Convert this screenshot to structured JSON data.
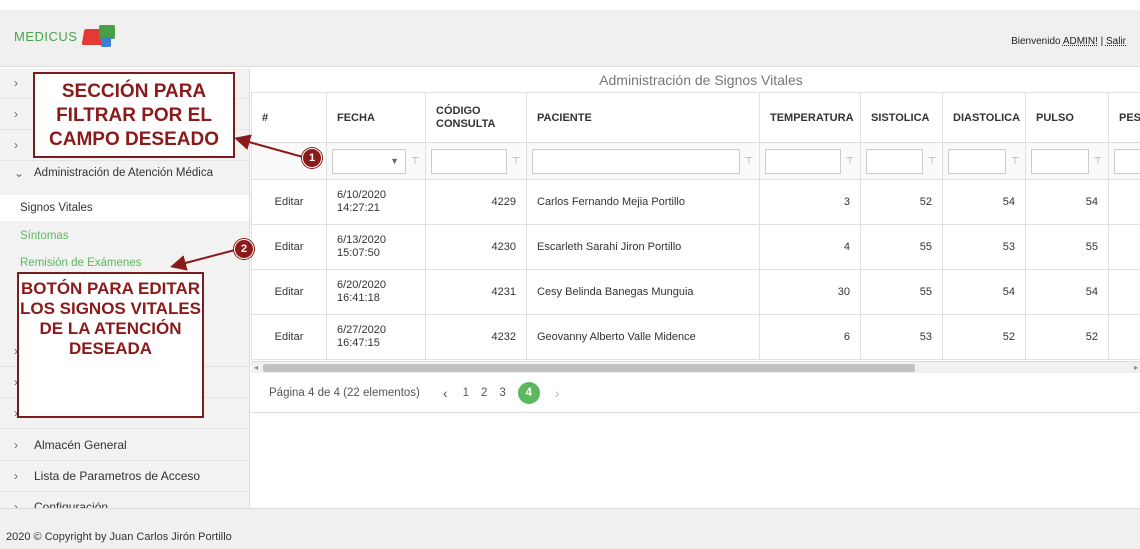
{
  "header": {
    "logo_text": "MEDICUS",
    "welcome_prefix": "Bienvenido",
    "user_link": "ADMIN!",
    "separator": "|",
    "logout_link": "Salir"
  },
  "sidebar": {
    "chevron_right": "›",
    "chevron_down": "⌄",
    "section_label": "Administración de Atención Médica",
    "sub_items": [
      {
        "label": "Signos Vitales"
      },
      {
        "label": "Síntomas"
      },
      {
        "label": "Remisión de Exámenes"
      }
    ],
    "bottom_items": [
      {
        "label": "Almacén General"
      },
      {
        "label": "Lista de Parametros de Acceso"
      },
      {
        "label": "Configuración"
      }
    ]
  },
  "grid": {
    "title": "Administración de Signos Vitales",
    "columns": [
      "#",
      "FECHA",
      "CÓDIGO CONSULTA",
      "PACIENTE",
      "TEMPERATURA",
      "SISTOLICA",
      "DIASTOLICA",
      "PULSO",
      "PES"
    ],
    "rows": [
      {
        "action": "Editar",
        "date": "6/10/2020",
        "time": "14:27:21",
        "code": "4229",
        "patient": "Carlos Fernando Mejia Portillo",
        "temp": "3",
        "sys": "52",
        "dia": "54",
        "pulse": "54"
      },
      {
        "action": "Editar",
        "date": "6/13/2020",
        "time": "15:07:50",
        "code": "4230",
        "patient": "Escarleth Sarahi Jiron Portillo",
        "temp": "4",
        "sys": "55",
        "dia": "53",
        "pulse": "55"
      },
      {
        "action": "Editar",
        "date": "6/20/2020",
        "time": "16:41:18",
        "code": "4231",
        "patient": "Cesy Belinda Banegas Munguia",
        "temp": "30",
        "sys": "55",
        "dia": "54",
        "pulse": "54"
      },
      {
        "action": "Editar",
        "date": "6/27/2020",
        "time": "16:47:15",
        "code": "4232",
        "patient": "Geovanny Alberto Valle Midence",
        "temp": "6",
        "sys": "53",
        "dia": "52",
        "pulse": "52"
      }
    ]
  },
  "pager": {
    "info": "Página 4 de 4 (22 elementos)",
    "prev": "‹",
    "next": "›",
    "pages": [
      "1",
      "2",
      "3",
      "4"
    ],
    "current": "4"
  },
  "footer": {
    "text": "2020 © Copyright by Juan Carlos Jirón Portillo"
  },
  "annotations": {
    "callout1": "SECCIÓN PARA FILTRAR POR EL CAMPO DESEADO",
    "badge1": "1",
    "callout2": "BOTÓN PARA EDITAR LOS SIGNOS VITALES DE LA ATENCIÓN DESEADA",
    "badge2": "2"
  },
  "colors": {
    "accent_green": "#5cb85c",
    "annotation_red": "#8b1a1a"
  }
}
